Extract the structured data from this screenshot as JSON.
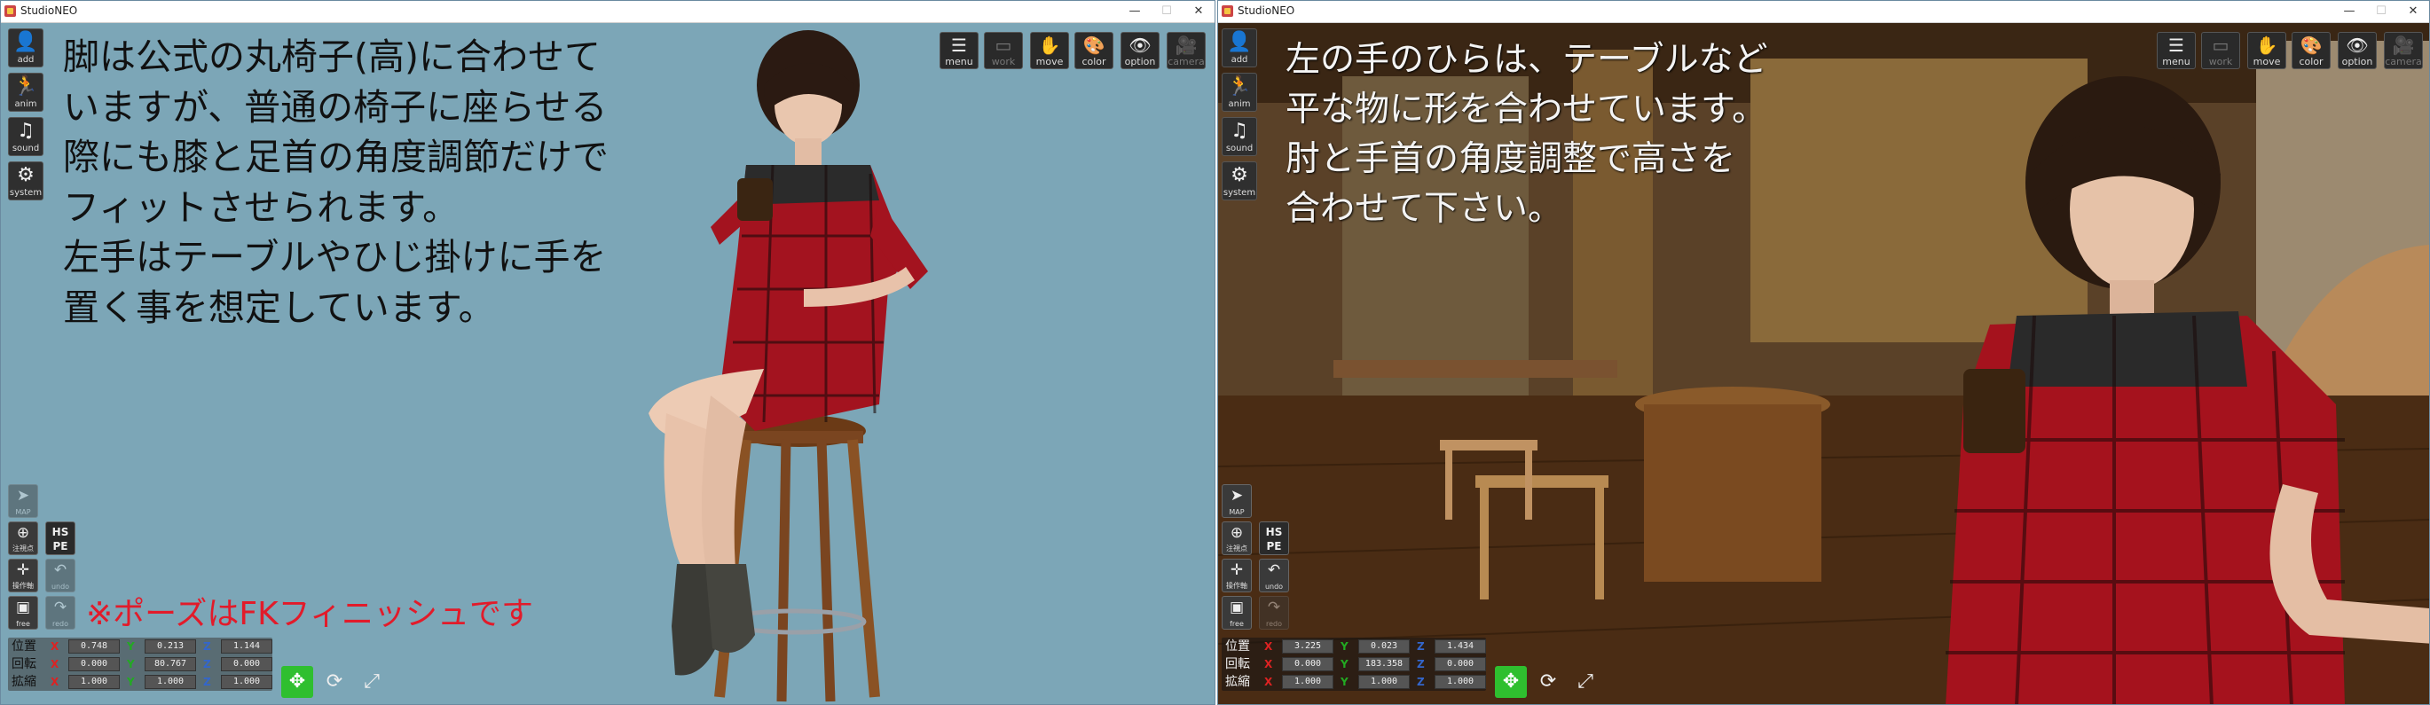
{
  "windows": [
    {
      "title": "StudioNEO",
      "caption": "脚は公式の丸椅子(高)に合わせて\nいますが、普通の椅子に座らせる\n際にも膝と足首の角度調節だけで\nフィットさせられます。\n左手はテーブルやひじ掛けに手を\n置く事を想定しています。",
      "note": "※ポーズはFKフィニッシュです",
      "transform": {
        "position": {
          "label": "位置",
          "x": "0.748",
          "y": "0.213",
          "z": "1.144"
        },
        "rotation": {
          "label": "回転",
          "x": "0.000",
          "y": "80.767",
          "z": "0.000"
        },
        "scale": {
          "label": "拡縮",
          "x": "1.000",
          "y": "1.000",
          "z": "1.000"
        }
      }
    },
    {
      "title": "StudioNEO",
      "caption": "左の手のひらは、テーブルなど\n平な物に形を合わせています。\n肘と手首の角度調整で高さを\n合わせて下さい。",
      "transform": {
        "position": {
          "label": "位置",
          "x": "3.225",
          "y": "0.023",
          "z": "1.434"
        },
        "rotation": {
          "label": "回転",
          "x": "0.000",
          "y": "183.358",
          "z": "0.000"
        },
        "scale": {
          "label": "拡縮",
          "x": "1.000",
          "y": "1.000",
          "z": "1.000"
        }
      }
    }
  ],
  "window_controls": {
    "minimize": "—",
    "maximize": "☐",
    "close": "✕"
  },
  "sidebar": {
    "add": "add",
    "anim": "anim",
    "sound": "sound",
    "system": "system",
    "map": "MAP",
    "focus": "注視点",
    "hspe": "HS\nPE",
    "axis": "操作軸",
    "undo": "undo",
    "free": "free",
    "redo": "redo"
  },
  "topmenu": {
    "menu": "menu",
    "work": "work",
    "move": "move",
    "color": "color",
    "option": "option",
    "camera": "camera"
  },
  "axis_labels": {
    "x": "X",
    "y": "Y",
    "z": "Z"
  },
  "icons": [
    "add-icon",
    "anim-icon",
    "sound-icon",
    "system-icon",
    "map-icon",
    "focus-icon",
    "axis-icon",
    "undo-icon",
    "free-icon",
    "redo-icon",
    "menu-icon",
    "work-icon",
    "move-icon",
    "color-icon",
    "option-icon",
    "camera-icon",
    "move-gizmo-icon",
    "rotate-gizmo-icon",
    "scale-gizmo-icon"
  ],
  "colors": {
    "left_background": "#7ca6b7",
    "note_red": "#e21b2a",
    "axis_x": "#dd2222",
    "axis_y": "#22aa22",
    "axis_z": "#3366cc",
    "gizmo_green": "#2fbf2f"
  }
}
